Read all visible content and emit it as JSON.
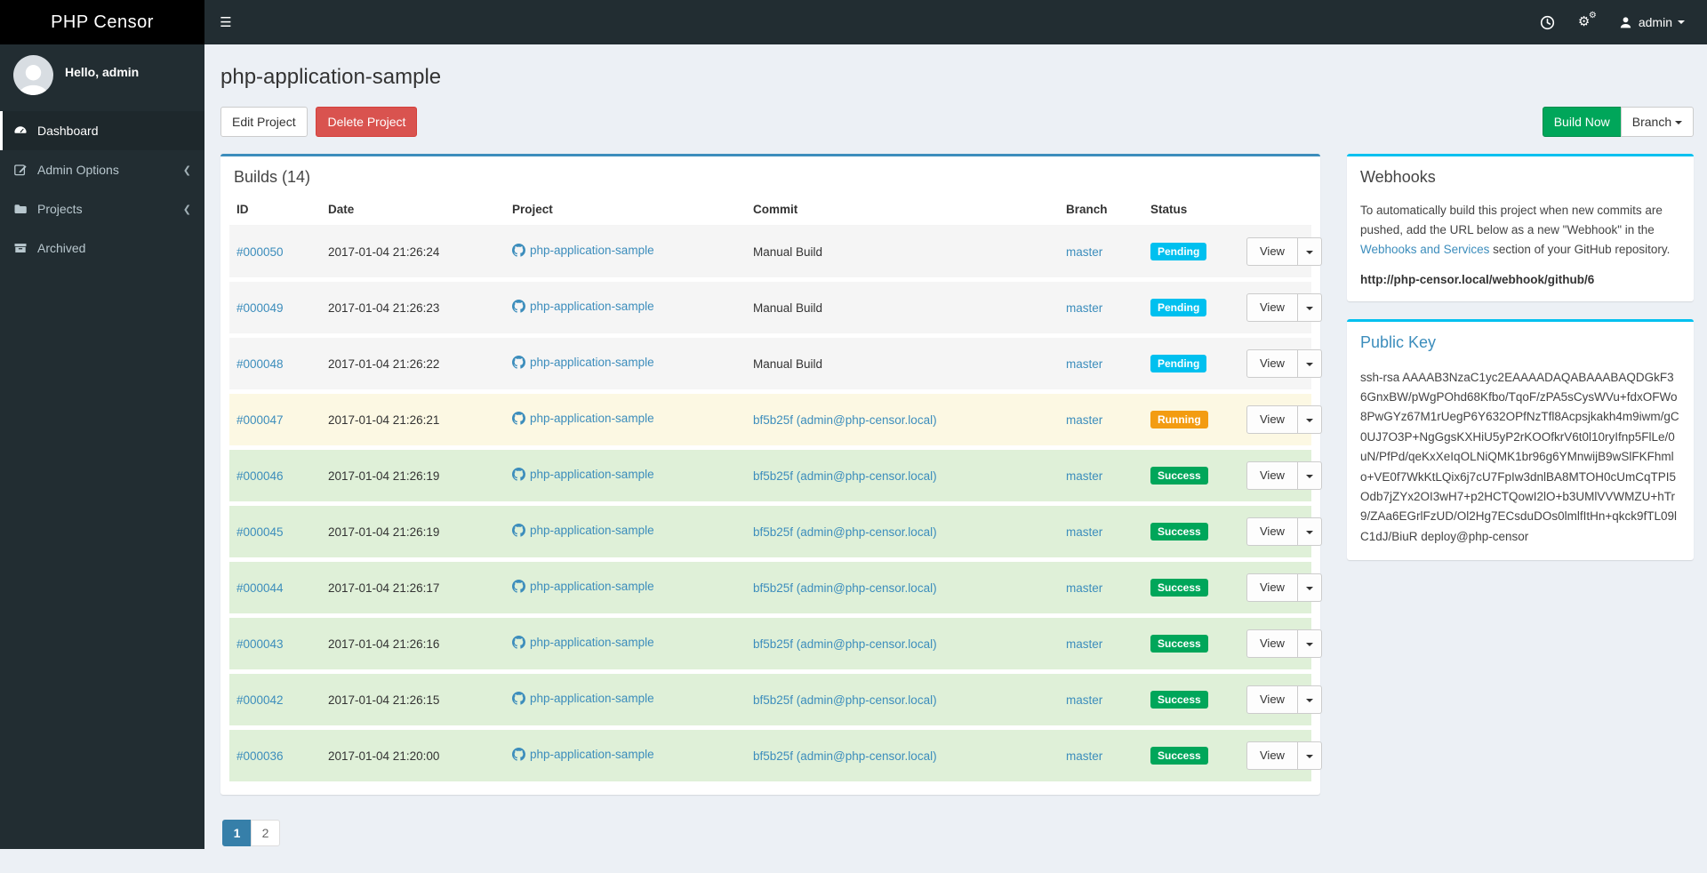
{
  "navbar": {
    "logo": "PHP Censor",
    "user_label": "admin",
    "icons": {
      "menu": "hamburger-icon",
      "history": "clock-icon",
      "settings": "cogs-icon",
      "user": "user-icon",
      "caret": "caret-down-icon"
    }
  },
  "sidebar": {
    "greeting": "Hello, admin",
    "items": [
      {
        "label": "Dashboard",
        "icon": "dashboard-icon",
        "active": true,
        "has_chevron": false
      },
      {
        "label": "Admin Options",
        "icon": "edit-icon",
        "active": false,
        "has_chevron": true
      },
      {
        "label": "Projects",
        "icon": "folder-icon",
        "active": false,
        "has_chevron": true
      },
      {
        "label": "Archived",
        "icon": "archive-icon",
        "active": false,
        "has_chevron": false
      }
    ],
    "chevron_icon": "angle-left-icon"
  },
  "page": {
    "title": "php-application-sample",
    "edit_button": "Edit Project",
    "delete_button": "Delete Project",
    "build_button": "Build Now",
    "branch_button": "Branch"
  },
  "builds": {
    "title": "Builds (14)",
    "columns": [
      "ID",
      "Date",
      "Project",
      "Commit",
      "Branch",
      "Status"
    ],
    "view_label": "View",
    "rows": [
      {
        "id": "#000050",
        "date": "2017-01-04 21:26:24",
        "project": "php-application-sample",
        "commit": "Manual Build",
        "commit_is_link": false,
        "branch": "master",
        "status": "Pending",
        "status_key": "pending"
      },
      {
        "id": "#000049",
        "date": "2017-01-04 21:26:23",
        "project": "php-application-sample",
        "commit": "Manual Build",
        "commit_is_link": false,
        "branch": "master",
        "status": "Pending",
        "status_key": "pending"
      },
      {
        "id": "#000048",
        "date": "2017-01-04 21:26:22",
        "project": "php-application-sample",
        "commit": "Manual Build",
        "commit_is_link": false,
        "branch": "master",
        "status": "Pending",
        "status_key": "pending"
      },
      {
        "id": "#000047",
        "date": "2017-01-04 21:26:21",
        "project": "php-application-sample",
        "commit": "bf5b25f (admin@php-censor.local)",
        "commit_is_link": true,
        "branch": "master",
        "status": "Running",
        "status_key": "running"
      },
      {
        "id": "#000046",
        "date": "2017-01-04 21:26:19",
        "project": "php-application-sample",
        "commit": "bf5b25f (admin@php-censor.local)",
        "commit_is_link": true,
        "branch": "master",
        "status": "Success",
        "status_key": "success"
      },
      {
        "id": "#000045",
        "date": "2017-01-04 21:26:19",
        "project": "php-application-sample",
        "commit": "bf5b25f (admin@php-censor.local)",
        "commit_is_link": true,
        "branch": "master",
        "status": "Success",
        "status_key": "success"
      },
      {
        "id": "#000044",
        "date": "2017-01-04 21:26:17",
        "project": "php-application-sample",
        "commit": "bf5b25f (admin@php-censor.local)",
        "commit_is_link": true,
        "branch": "master",
        "status": "Success",
        "status_key": "success"
      },
      {
        "id": "#000043",
        "date": "2017-01-04 21:26:16",
        "project": "php-application-sample",
        "commit": "bf5b25f (admin@php-censor.local)",
        "commit_is_link": true,
        "branch": "master",
        "status": "Success",
        "status_key": "success"
      },
      {
        "id": "#000042",
        "date": "2017-01-04 21:26:15",
        "project": "php-application-sample",
        "commit": "bf5b25f (admin@php-censor.local)",
        "commit_is_link": true,
        "branch": "master",
        "status": "Success",
        "status_key": "success"
      },
      {
        "id": "#000036",
        "date": "2017-01-04 21:20:00",
        "project": "php-application-sample",
        "commit": "bf5b25f (admin@php-censor.local)",
        "commit_is_link": true,
        "branch": "master",
        "status": "Success",
        "status_key": "success"
      }
    ],
    "project_icon": "github-icon"
  },
  "pagination": {
    "pages": [
      "1",
      "2"
    ],
    "active": "1"
  },
  "webhooks": {
    "title": "Webhooks",
    "text_before_link": "To automatically build this project when new commits are pushed, add the URL below as a new \"Webhook\" in the ",
    "link_text": "Webhooks and Services",
    "text_after_link": " section of your GitHub repository.",
    "url": "http://php-censor.local/webhook/github/6"
  },
  "public_key": {
    "title": "Public Key",
    "key": "ssh-rsa AAAAB3NzaC1yc2EAAAADAQABAAABAQDGkF36GnxBW/pWgPOhd68Kfbo/TqoF/zPA5sCysWVu+fdxOFWo8PwGYz67M1rUegP6Y632OPfNzTfl8Acpsjkakh4m9iwm/gC0UJ7O3P+NgGgsKXHiU5yP2rKOOfkrV6t0l10ryIfnp5FlLe/0uN/PfPd/qeKxXeIqOLNiQMK1br96g6YMnwijB9wSlFKFhmlo+VE0f7WkKtLQix6j7cU7FpIw3dnlBA8MTOH0cUmCqTPI5Odb7jZYx2OI3wH7+p2HCTQowI2lO+b3UMlVVWMZU+hTr9/ZAa6EGrlFzUD/Ol2Hg7ECsduDOs0lmlfItHn+qkck9fTL09lC1dJ/BiuR deploy@php-censor"
  },
  "colors": {
    "accent_primary": "#3c8dbc",
    "accent_info": "#00c0ef",
    "sidebar_bg": "#222d32",
    "logo_bg": "#000000",
    "content_bg": "#ecf0f5",
    "link": "#3c8dbc",
    "button_success": "#00a65a",
    "button_danger": "#d9534f",
    "pagination_active": "#367fa9",
    "status_badges": {
      "pending": "#00c0ef",
      "running": "#f39c12",
      "success": "#00a65a"
    },
    "row_backgrounds": {
      "pending": "#f5f5f5",
      "running": "#fcf8e3",
      "success": "#dff0d8"
    }
  }
}
